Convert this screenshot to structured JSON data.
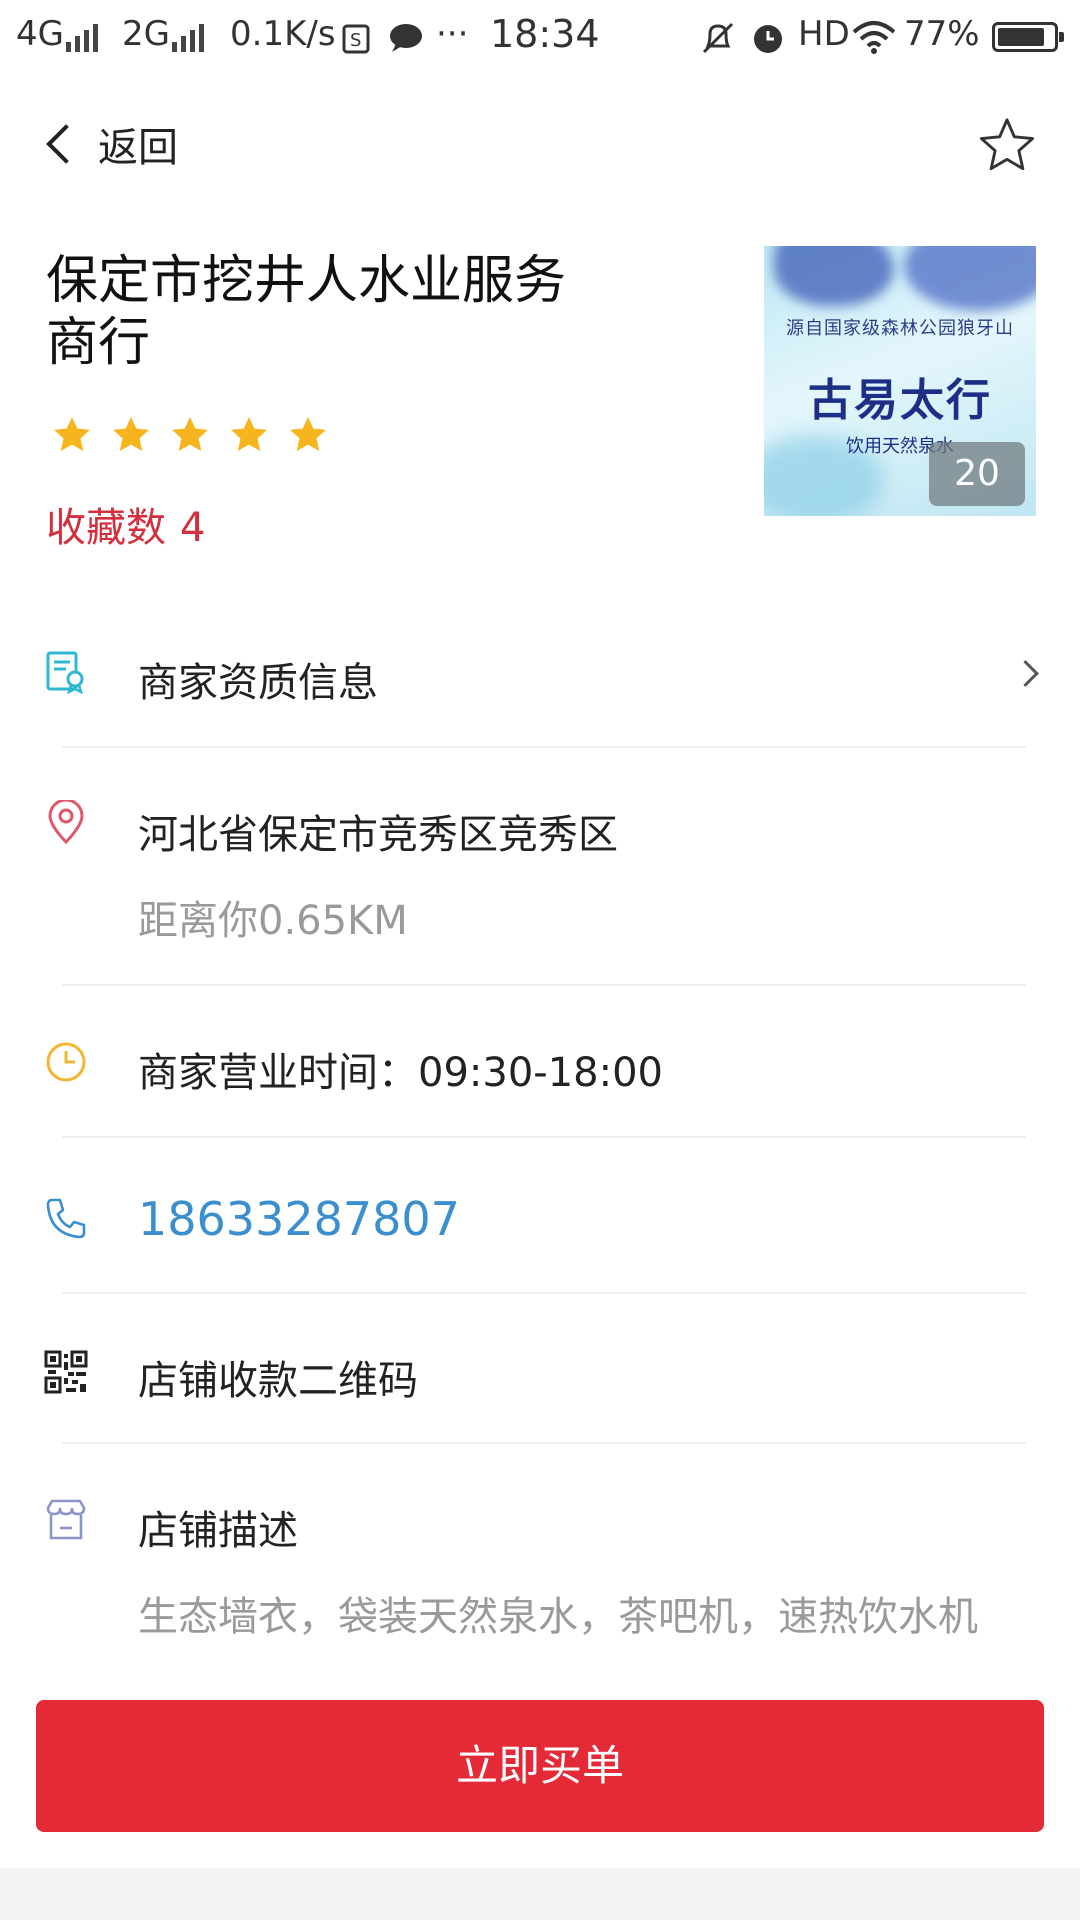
{
  "status_bar": {
    "net1": "4G",
    "net2": "2G",
    "speed": "0.1K/s",
    "dots": "···",
    "time": "18:34",
    "hd": "HD",
    "battery": "77%"
  },
  "header": {
    "back_label": "返回"
  },
  "store": {
    "title": "保定市挖井人水业服务商行",
    "rating": 5,
    "fav_label": "收藏数",
    "fav_count": "4",
    "image": {
      "line1": "源自国家级森林公园狼牙山",
      "brand": "古易太行",
      "line2": "饮用天然泉水",
      "count": "20"
    }
  },
  "rows": {
    "qualification": "商家资质信息",
    "address": "河北省保定市竞秀区竞秀区",
    "distance": "距离你0.65KM",
    "hours": "商家营业时间：09:30-18:00",
    "phone": "18633287807",
    "qrcode": "店铺收款二维码",
    "desc_title": "店铺描述",
    "desc": "生态墙衣，袋装天然泉水，茶吧机，速热饮水机"
  },
  "buy_button": "立即买单",
  "colors": {
    "accent_red": "#e32a36",
    "fav_red": "#d3303f",
    "phone_blue": "#3b8fce",
    "star_gold": "#f6b51e"
  }
}
